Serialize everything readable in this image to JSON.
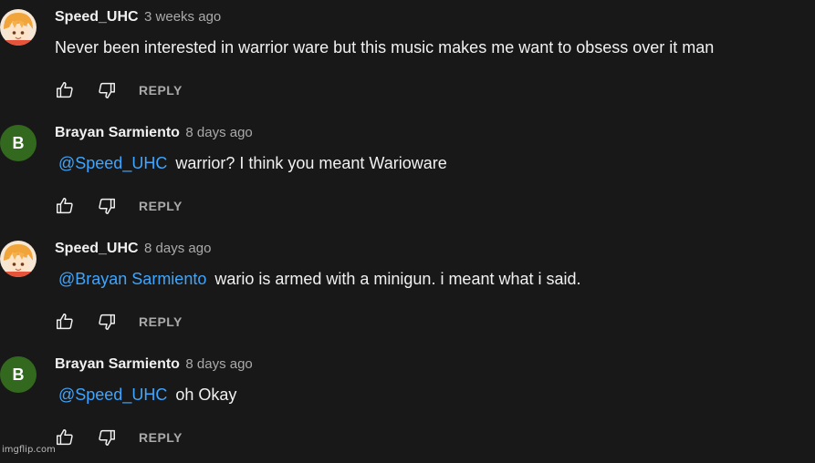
{
  "comments": [
    {
      "author": "Speed_UHC",
      "time": "3 weeks ago",
      "avatar_type": "anime-avatar",
      "mention": "",
      "text": "Never been interested in warrior ware but this music makes me want to obsess over it man",
      "reply_label": "REPLY"
    },
    {
      "author": "Brayan Sarmiento",
      "time": "8 days ago",
      "avatar_type": "letter",
      "avatar_letter": "B",
      "mention": "@Speed_UHC",
      "text": "warrior? I think you meant Warioware",
      "reply_label": "REPLY"
    },
    {
      "author": "Speed_UHC",
      "time": "8 days ago",
      "avatar_type": "anime-avatar",
      "mention": "@Brayan Sarmiento",
      "text": "wario is armed with a minigun. i meant what i said.",
      "reply_label": "REPLY"
    },
    {
      "author": "Brayan Sarmiento",
      "time": "8 days ago",
      "avatar_type": "letter",
      "avatar_letter": "B",
      "mention": "@Speed_UHC",
      "text": "oh Okay",
      "reply_label": "REPLY"
    }
  ],
  "colors": {
    "background": "#181818",
    "text": "#f1f1f1",
    "meta": "#aaaaaa",
    "mention": "#3ea6ff",
    "letter_avatar": "#33691e"
  },
  "icons": {
    "like": "thumb-up-icon",
    "dislike": "thumb-down-icon"
  },
  "watermark": "imgflip.com"
}
